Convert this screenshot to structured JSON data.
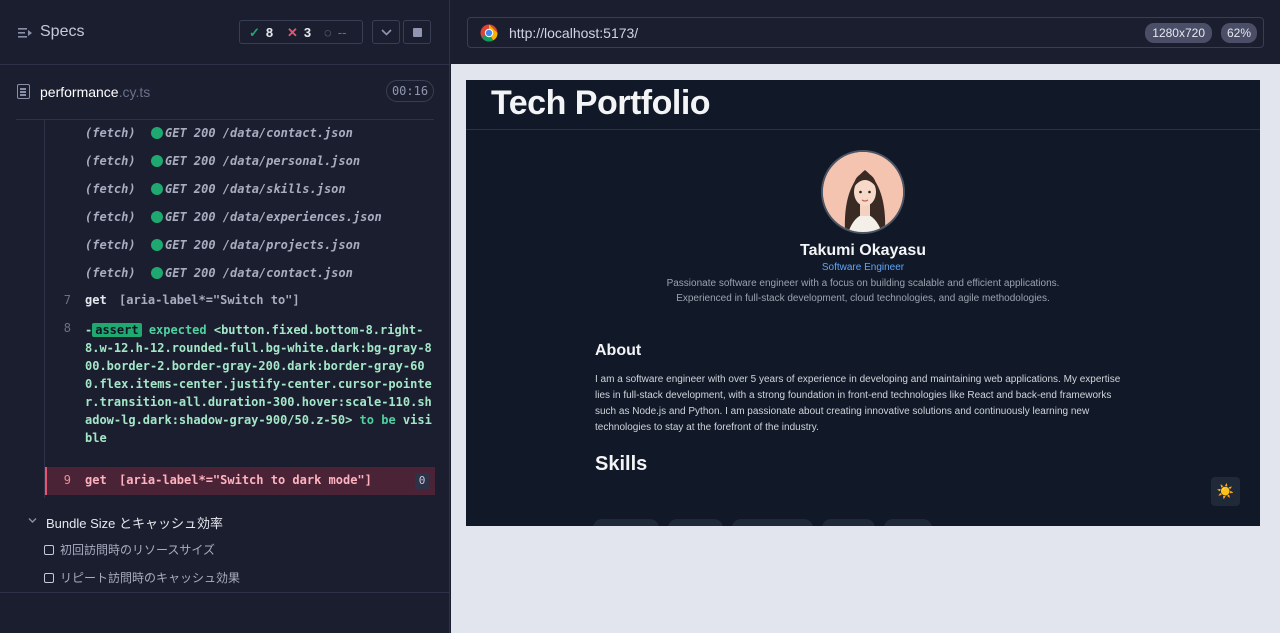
{
  "runner": {
    "header": {
      "title": "Specs",
      "passed": "8",
      "failed": "3",
      "pending": "--"
    },
    "spec": {
      "name": "performance",
      "ext": ".cy.ts",
      "duration": "00:16"
    },
    "log": {
      "fetches": [
        {
          "label": "(fetch)",
          "message": "GET 200 /data/contact.json"
        },
        {
          "label": "(fetch)",
          "message": "GET 200 /data/personal.json"
        },
        {
          "label": "(fetch)",
          "message": "GET 200 /data/skills.json"
        },
        {
          "label": "(fetch)",
          "message": "GET 200 /data/experiences.json"
        },
        {
          "label": "(fetch)",
          "message": "GET 200 /data/projects.json"
        },
        {
          "label": "(fetch)",
          "message": "GET 200 /data/contact.json"
        }
      ],
      "cmd7": {
        "num": "7",
        "name": "get",
        "arg": "[aria-label*=\"Switch to\"]"
      },
      "cmd8": {
        "num": "8",
        "prefix": "-",
        "tag": "assert",
        "expected": "expected",
        "selector": "<button.fixed.bottom-8.right-8.w-12.h-12.rounded-full.bg-white.dark:bg-gray-800.border-2.border-gray-200.dark:border-gray-600.flex.items-center.justify-center.cursor-pointer.transition-all.duration-300.hover:scale-110.shadow-lg.dark:shadow-gray-900/50.z-50>",
        "to_be": "to be",
        "state": "visible"
      },
      "cmd9": {
        "num": "9",
        "name": "get",
        "arg": "[aria-label*=\"Switch to dark mode\"]",
        "count": "0"
      }
    },
    "suite": {
      "title": "Bundle Size とキャッシュ効率",
      "tests": [
        "初回訪問時のリソースサイズ",
        "リピート訪問時のキャッシュ効果"
      ]
    }
  },
  "browser": {
    "url": "http://localhost:5173/",
    "viewport": "1280x720",
    "zoom": "62%"
  },
  "site": {
    "title": "Tech Portfolio",
    "name": "Takumi Okayasu",
    "role": "Software Engineer",
    "description": "Passionate software engineer with a focus on building scalable and efficient applications. Experienced in full-stack development, cloud technologies, and agile methodologies.",
    "about_heading": "About",
    "about_text": "I am a software engineer with over 5 years of experience in developing and maintaining web applications. My expertise lies in full-stack development, with a strong foundation in front-end technologies like React and back-end frameworks such as Node.js and Python. I am passionate about creating innovative solutions and continuously learning new technologies to stay at the forefront of the industry.",
    "skills_heading": "Skills",
    "theme_icon": "☀️"
  },
  "colors": {
    "pass": "#1fa971",
    "fail": "#e45770",
    "link": "#60a5fa"
  }
}
